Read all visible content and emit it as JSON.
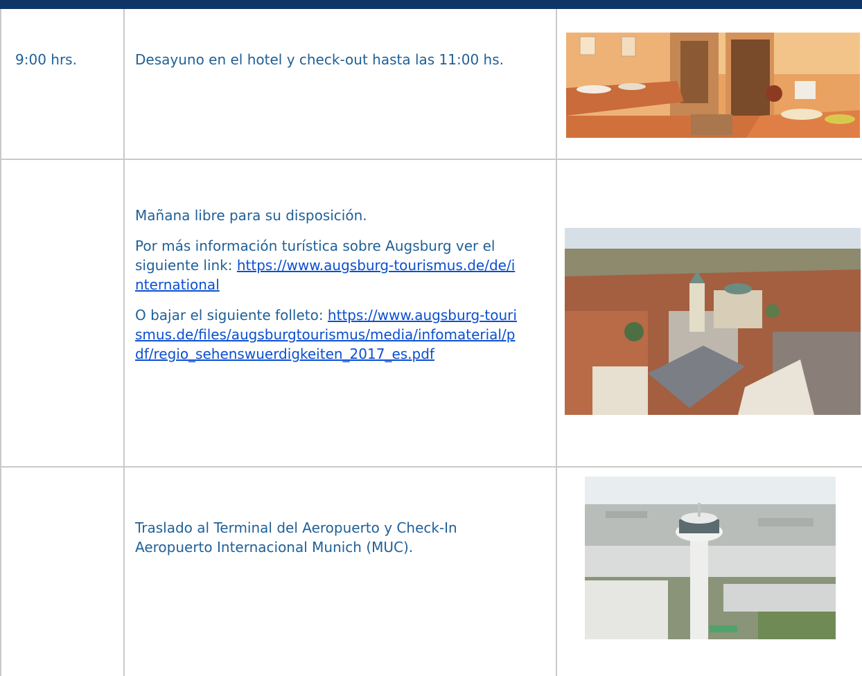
{
  "rows": [
    {
      "time": "9:00 hrs.",
      "lines": [
        "Desayuno en el hotel y check-out hasta las 11:00 hs."
      ],
      "image": "hotel-breakfast-buffet-photo"
    },
    {
      "time": "",
      "intro": "Mañana libre para su disposición.",
      "info_prefix": "Por más información turística sobre Augsburg ver el siguiente link: ",
      "info_link": "https://www.augsburg-tourismus.de/de/international",
      "brochure_prefix": "O bajar el siguiente folleto: ",
      "brochure_link": "https://www.augsburg-tourismus.de/files/augsburgtourismus/media/infomaterial/pdf/regio_sehenswuerdigkeiten_2017_es.pdf",
      "image": "augsburg-aerial-photo"
    },
    {
      "time": "",
      "lines": [
        "Traslado al Terminal del Aeropuerto y Check-In Aeropuerto Internacional Munich (MUC)."
      ],
      "image": "munich-airport-tower-photo"
    }
  ],
  "colors": {
    "header_bar": "#0e3566",
    "text": "#1f5f97",
    "link": "#0b4fd0",
    "grid": "#c9c9c9"
  }
}
